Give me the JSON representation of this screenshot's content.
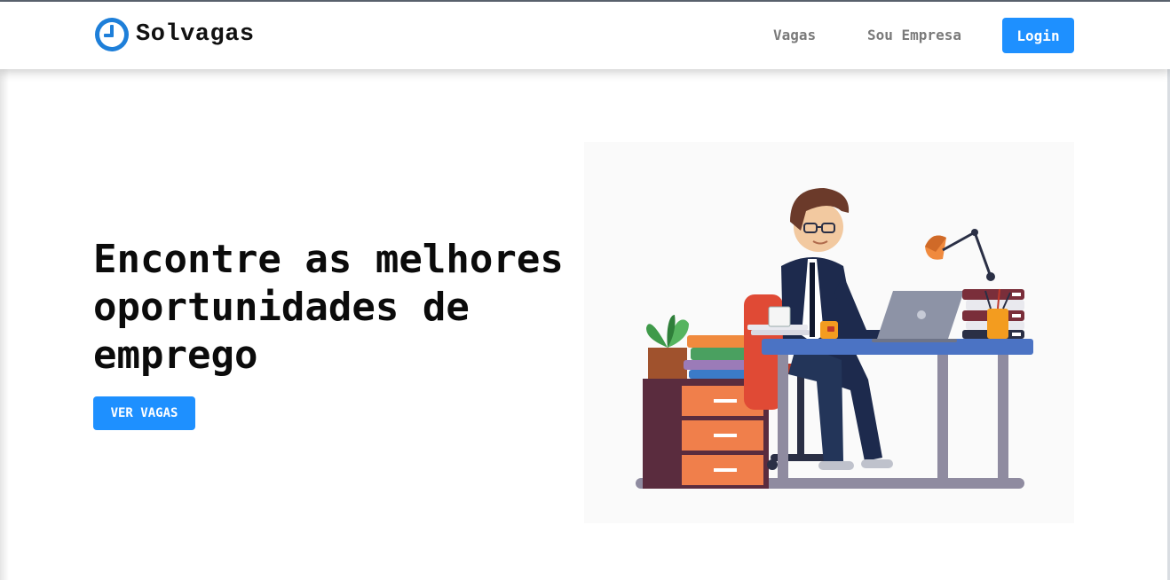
{
  "brand": {
    "name": "Solvagas",
    "icon": "clock-icon",
    "color": "#1e90ff"
  },
  "nav": {
    "links": [
      {
        "label": "Vagas"
      },
      {
        "label": "Sou Empresa"
      }
    ],
    "login_label": "Login"
  },
  "hero": {
    "title": "Encontre as melhores oportunidades de emprego",
    "cta_label": "VER VAGAS",
    "illustration": "man-working-at-desk-illustration"
  },
  "colors": {
    "accent": "#1e90ff",
    "text": "#0b0b0b",
    "nav_text": "#7a7a7a"
  }
}
